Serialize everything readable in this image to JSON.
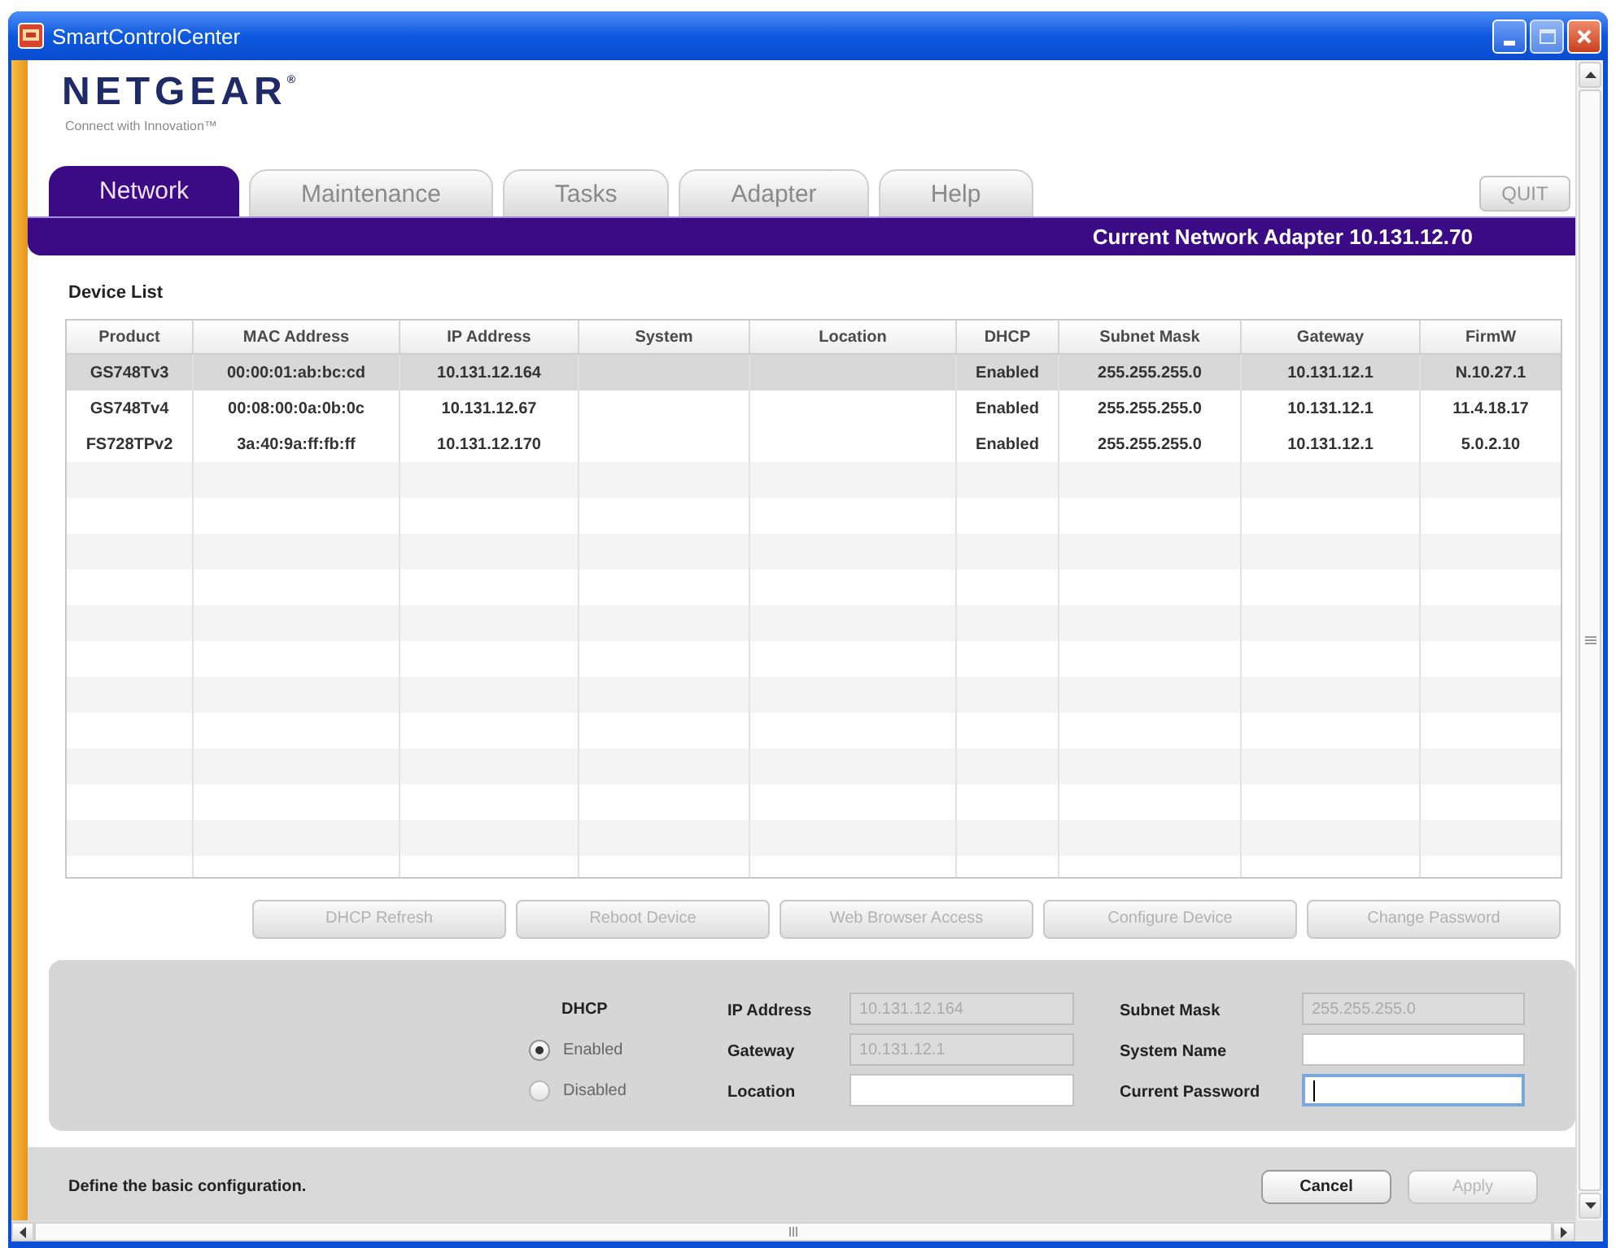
{
  "window": {
    "title": "SmartControlCenter"
  },
  "brand": {
    "name": "NETGEAR$^{®}$",
    "tagline": "Connect with Innovation™"
  },
  "tabs": [
    {
      "label": "Network",
      "selected": true
    },
    {
      "label": "Maintenance",
      "selected": false
    },
    {
      "label": "Tasks",
      "selected": false
    },
    {
      "label": "Adapter",
      "selected": false
    },
    {
      "label": "Help",
      "selected": false
    }
  ],
  "quit_button": "QUIT",
  "adapter_bar": "Current Network Adapter 10.131.12.70",
  "device_list": {
    "title": "Device List",
    "columns": [
      "Product",
      "MAC Address",
      "IP Address",
      "System",
      "Location",
      "DHCP",
      "Subnet Mask",
      "Gateway",
      "FirmW"
    ],
    "rows": [
      {
        "selected": true,
        "cells": [
          "GS748Tv3",
          "00:00:01:ab:bc:cd",
          "10.131.12.164",
          null,
          null,
          "Enabled",
          "255.255.255.0",
          "10.131.12.1",
          "N.10.27.1"
        ]
      },
      {
        "selected": false,
        "cells": [
          "GS748Tv4",
          "00:08:00:0a:0b:0c",
          "10.131.12.67",
          null,
          null,
          "Enabled",
          "255.255.255.0",
          "10.131.12.1",
          "11.4.18.17"
        ]
      },
      {
        "selected": false,
        "cells": [
          "FS728TPv2",
          "3a:40:9a:ff:fb:ff",
          "10.131.12.170",
          null,
          null,
          "Enabled",
          "255.255.255.0",
          "10.131.12.1",
          "5.0.2.10"
        ]
      }
    ]
  },
  "action_buttons": [
    {
      "label": "DHCP Refresh",
      "disabled": true
    },
    {
      "label": "Reboot Device",
      "disabled": true
    },
    {
      "label": "Web Browser Access",
      "disabled": true
    },
    {
      "label": "Configure Device",
      "disabled": true
    },
    {
      "label": "Change Password",
      "disabled": true
    }
  ],
  "config": {
    "dhcp": {
      "label": "DHCP",
      "options": [
        {
          "label": "Enabled",
          "selected": true
        },
        {
          "label": "Disabled",
          "selected": false
        }
      ]
    },
    "field_columns": [
      [
        {
          "label": "IP Address",
          "value": "10.131.12.164",
          "disabled": true,
          "focused": false
        },
        {
          "label": "Gateway",
          "value": "10.131.12.1",
          "disabled": true,
          "focused": false
        },
        {
          "label": "Location",
          "disabled": false,
          "focused": false
        }
      ],
      [
        {
          "label": "Subnet Mask",
          "value": "255.255.255.0",
          "disabled": true,
          "focused": false
        },
        {
          "label": "System Name",
          "disabled": false,
          "focused": false
        },
        {
          "label": "Current Password",
          "disabled": false,
          "focused": true
        }
      ]
    ]
  },
  "status_bar": {
    "text": "Define the basic configuration.",
    "buttons": [
      {
        "label": "Cancel",
        "disabled": false
      },
      {
        "label": "Apply",
        "disabled": true
      }
    ]
  }
}
